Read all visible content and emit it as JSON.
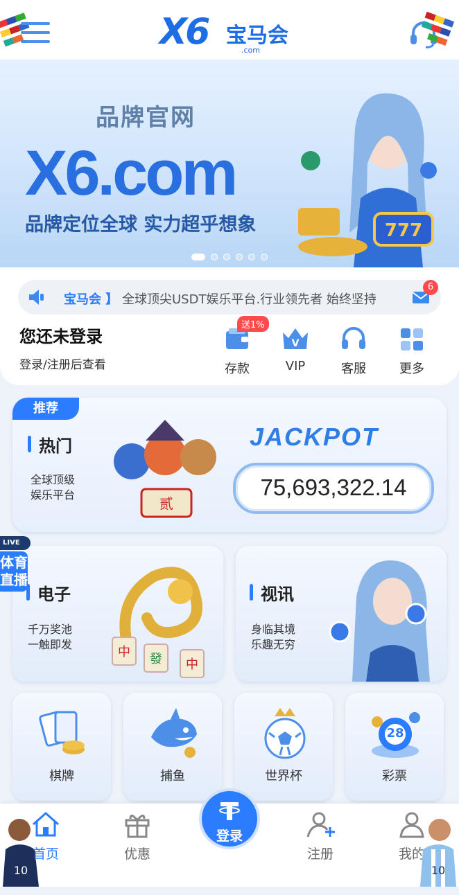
{
  "header": {
    "logo_x6": "X6",
    "logo_cn": "宝马会",
    "logo_com": ".com"
  },
  "banner": {
    "tagline": "品牌官网",
    "url": "X6.com",
    "slogan": "品牌定位全球  实力超乎想象",
    "slide_count": 6,
    "active_slide": 1
  },
  "notice": {
    "brand": "宝马会 】",
    "text": "全球顶尖USDT娱乐平台.行业领先者 始终坚持",
    "mail_badge": "6"
  },
  "user": {
    "title": "您还未登录",
    "subtitle": "登录/注册后查看"
  },
  "quick_actions": {
    "deposit": "存款",
    "deposit_badge": "送1%",
    "vip": "VIP",
    "service": "客服",
    "more": "更多"
  },
  "hot": {
    "tag": "推荐",
    "title": "热门",
    "subtitle_line1": "全球顶级",
    "subtitle_line2": "娱乐平台",
    "jackpot_title": "JACKPOT",
    "jackpot_value": "75,693,322.14"
  },
  "electronic": {
    "title": "电子",
    "sub1": "千万奖池",
    "sub2": "一触即发"
  },
  "video": {
    "title": "视讯",
    "sub1": "身临其境",
    "sub2": "乐趣无穷"
  },
  "sports_tab": {
    "live": "LIVE",
    "text": "体育直播"
  },
  "small_games": [
    "棋牌",
    "捕鱼",
    "世界杯",
    "彩票"
  ],
  "lottery_ball": "28",
  "nav": {
    "home": "首页",
    "promo": "优惠",
    "login": "登录",
    "register": "注册",
    "mine": "我的"
  },
  "colors": {
    "accent": "#2b7cff",
    "badge": "#ff4b4b"
  }
}
